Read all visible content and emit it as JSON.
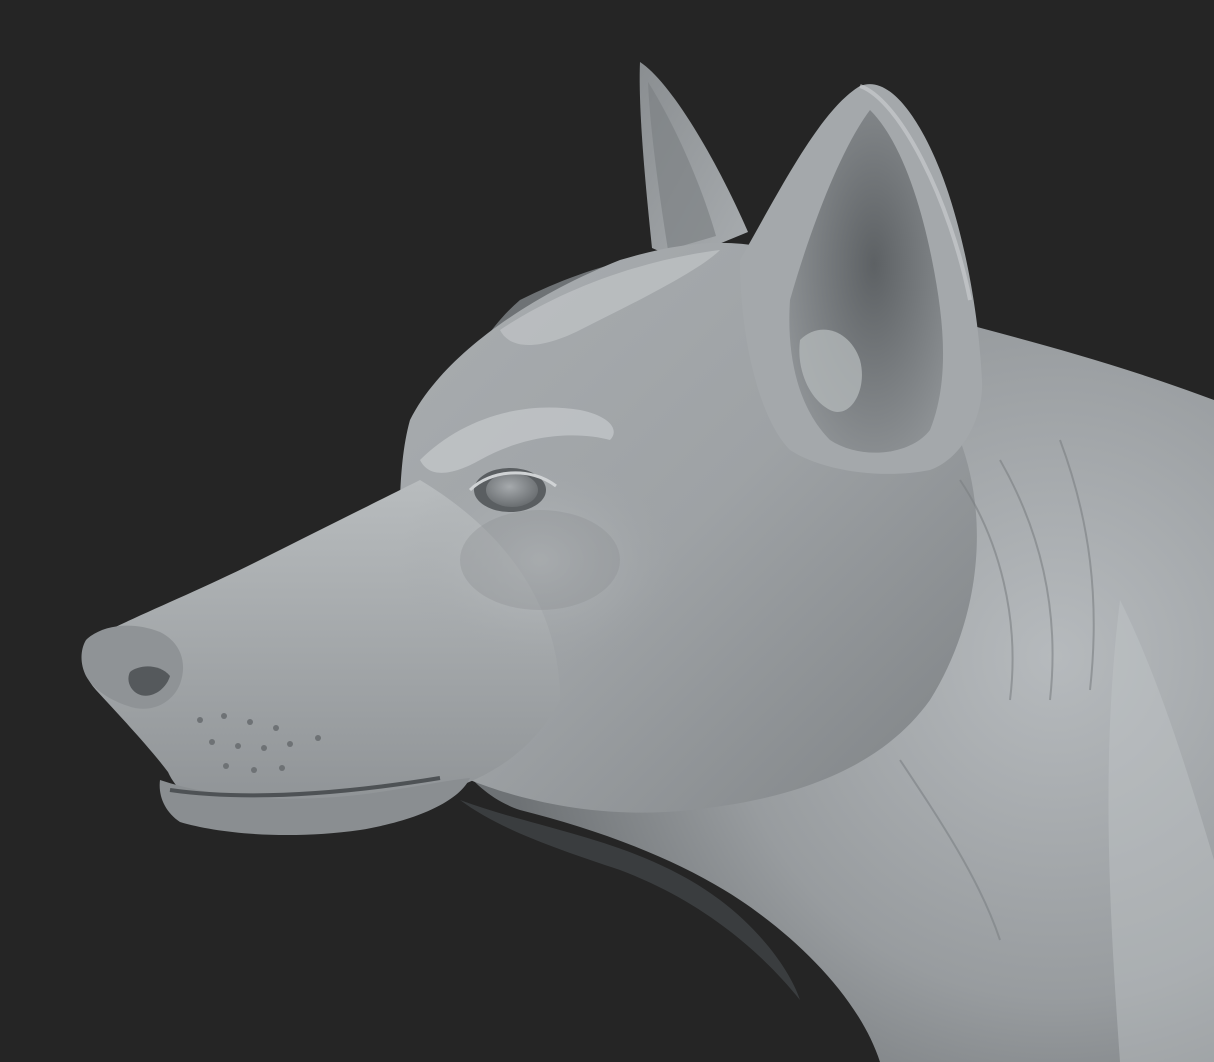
{
  "scene": {
    "subject": "dog-head-sculpt",
    "colors": {
      "background": "#252525",
      "clay_light": "#b4b8bb",
      "clay_mid": "#8e9295",
      "clay_dark": "#4f5356",
      "clay_shadow": "#2f3234",
      "highlight": "#d3d6d8"
    }
  }
}
